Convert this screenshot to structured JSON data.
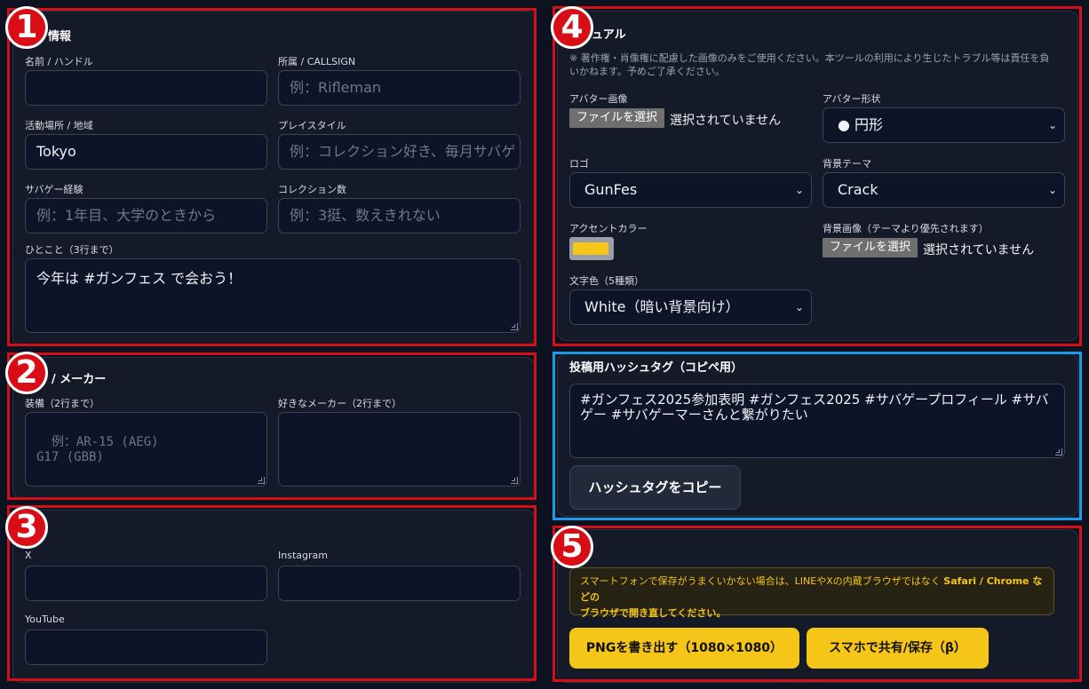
{
  "badges": [
    "1",
    "2",
    "3",
    "4",
    "5"
  ],
  "basic": {
    "title": "情報",
    "name_label": "名前 / ハンドル",
    "name_value": "",
    "callsign_label": "所属 / CALLSIGN",
    "callsign_placeholder": "例：Rifleman",
    "area_label": "活動場所 / 地域",
    "area_value": "Tokyo",
    "style_label": "プレイスタイル",
    "style_placeholder": "例：コレクション好き、毎月サバゲ",
    "exp_label": "サバゲー経験",
    "exp_placeholder": "例：1年目、大学のときから",
    "collection_label": "コレクション数",
    "collection_placeholder": "例：3挺、数えきれない",
    "comment_label": "ひとこと（3行まで）",
    "comment_value": "今年は #ガンフェス で会おう！"
  },
  "gear": {
    "title": "/ メーカー",
    "equip_label": "装備（2行まで）",
    "equip_placeholder": "例：AR-15 (AEG)\nG17 (GBB)",
    "maker_label": "好きなメーカー（2行まで）",
    "maker_value": ""
  },
  "sns": {
    "x_label": "X",
    "instagram_label": "Instagram",
    "youtube_label": "YouTube"
  },
  "visual": {
    "title": "ュアル",
    "note": "※ 著作権・肖像権に配慮した画像のみをご使用ください。本ツールの利用により生じたトラブル等は責任を負いかねます。予めご了承ください。",
    "avatar_label": "アバター画像",
    "file_button": "ファイルを選択",
    "no_file": "選択されていません",
    "avatar_shape_label": "アバター形状",
    "avatar_shape_value": "● 円形",
    "logo_label": "ロゴ",
    "logo_value": "GunFes",
    "bg_theme_label": "背景テーマ",
    "bg_theme_value": "Crack",
    "accent_label": "アクセントカラー",
    "accent_color": "#f5c518",
    "bg_image_label": "背景画像（テーマより優先されます）",
    "text_color_label": "文字色（5種類）",
    "text_color_value": "White（暗い背景向け）"
  },
  "hashtags": {
    "title": "投稿用ハッシュタグ（コピペ用）",
    "value": "#ガンフェス2025参加表明 #ガンフェス2025 #サバゲープロフィール #サバゲー #サバゲーマーさんと繋がりたい",
    "copy_button": "ハッシュタグをコピー"
  },
  "export": {
    "warning_1": "スマートフォンで保存がうまくいかない場合は、LINEやXの内蔵ブラウザではなく ",
    "warning_bold": "Safari / Chrome などの",
    "warning_2": "ブラウザで開き直してください。",
    "png_button": "PNGを書き出す（1080×1080）",
    "share_button": "スマホで共有/保存（β）"
  }
}
